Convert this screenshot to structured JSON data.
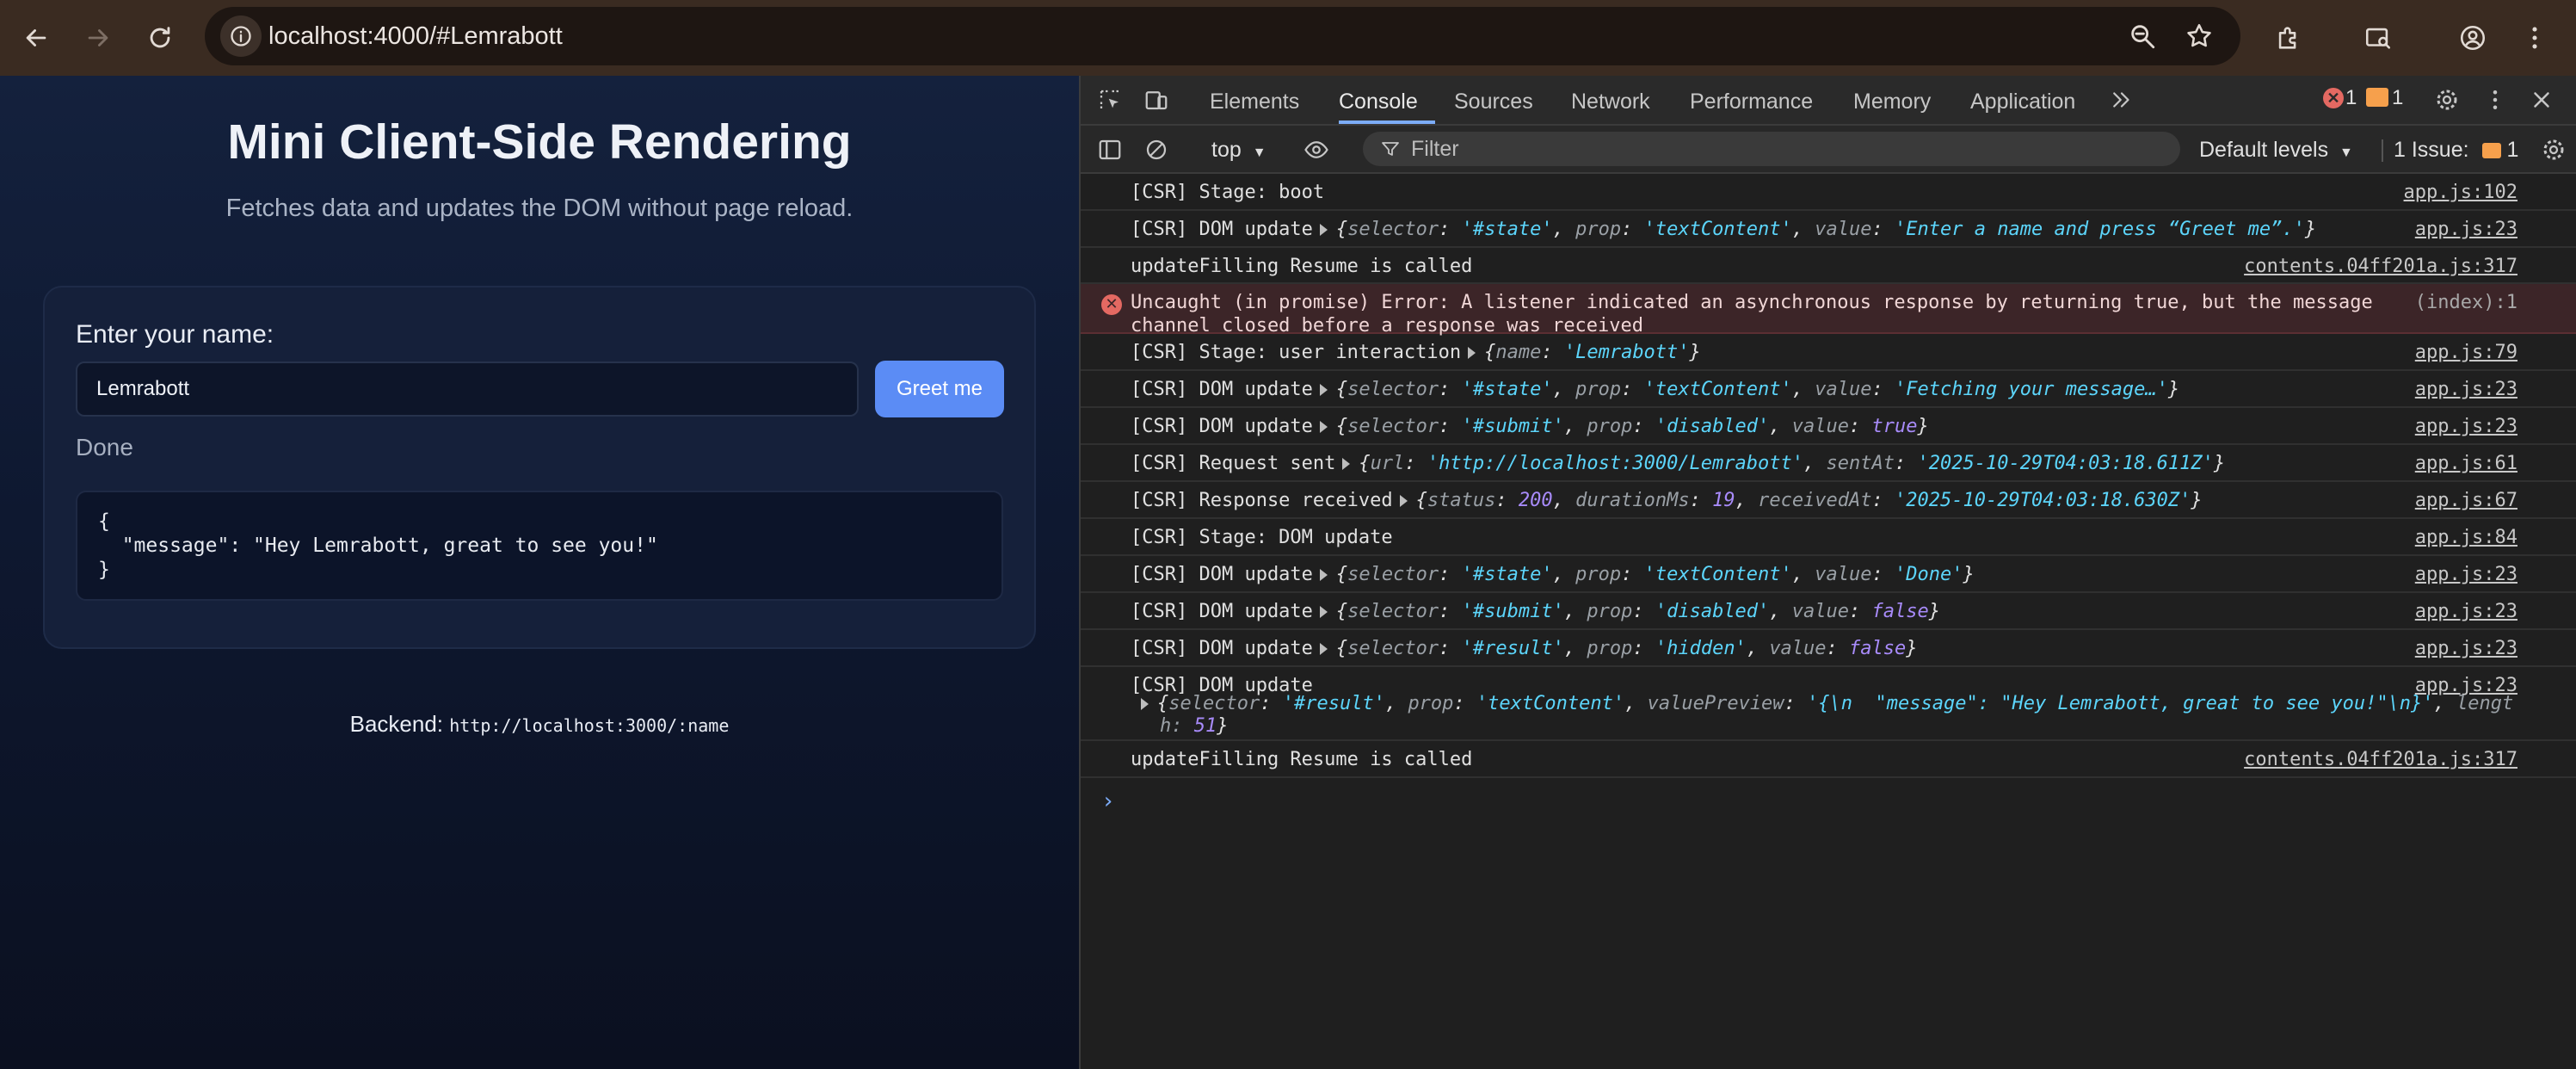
{
  "browser": {
    "url": "localhost:4000/#Lemrabott"
  },
  "page": {
    "title": "Mini Client-Side Rendering",
    "subtitle": "Fetches data and updates the DOM without page reload.",
    "name_label": "Enter your name:",
    "name_value": "Lemrabott",
    "greet_button": "Greet me",
    "state": "Done",
    "result": "{\n  \"message\": \"Hey Lemrabott, great to see you!\"\n}",
    "backend_label": "Backend:",
    "backend_url": "http://localhost:3000/:name"
  },
  "devtools": {
    "tabs": [
      "Elements",
      "Console",
      "Sources",
      "Network",
      "Performance",
      "Memory",
      "Application"
    ],
    "active_tab": "Console",
    "error_count": "1",
    "warning_count": "1",
    "context": "top",
    "filter_placeholder": "Filter",
    "levels": "Default levels",
    "issues_label": "1 Issue:",
    "issues_count": "1",
    "console": {
      "r1_msg": "[CSR] Stage: boot",
      "r1_src": "app.js:102",
      "r2_msg": "[CSR] DOM update",
      "r2_src": "app.js:23",
      "r2_state": "'#state'",
      "r2_prop": "'textContent'",
      "r2_value": "'Enter a name and press “Greet me”.'",
      "r3_msg": "updateFilling Resume is called",
      "r3_src": "contents.04ff201a.js:317",
      "r4_msg": "Uncaught (in promise) Error: A listener indicated an asynchronous response by returning true, but the message\nchannel closed before a response was received",
      "r4_src": "(index):1",
      "r5_msg": "[CSR] Stage: user interaction",
      "r5_name": "'Lemrabott'",
      "r5_src": "app.js:79",
      "r6_msg": "[CSR] DOM update",
      "r6_value": "'Fetching your message…'",
      "r6_src": "app.js:23",
      "r7_msg": "[CSR] DOM update",
      "r7_value": "true",
      "r7_src": "app.js:23",
      "r8_msg": "[CSR] Request sent",
      "r8_url": "'http://localhost:3000/Lemrabott'",
      "r8_sent": "'2025-10-29T04:03:18.611Z'",
      "r8_src": "app.js:61",
      "r9_msg": "[CSR] Response received",
      "r9_status": "200",
      "r9_duration": "19",
      "r9_received": "'2025-10-29T04:03:18.630Z'",
      "r9_src": "app.js:67",
      "r10_msg": "[CSR] Stage: DOM update",
      "r10_src": "app.js:84",
      "r11_msg": "[CSR] DOM update",
      "r11_value": "'Done'",
      "r11_src": "app.js:23",
      "r12_msg": "[CSR] DOM update",
      "r12_value": "false",
      "r12_src": "app.js:23",
      "r13_msg": "[CSR] DOM update",
      "r13_value": "false",
      "r13_src": "app.js:23",
      "r14_msg": "[CSR] DOM update",
      "r14_preview": "'{\\n  \"message\": \"Hey Lemrabott, great to see you!\"\\n}'",
      "r14_len1": "lengt",
      "r14_len2": "h:",
      "r14_len_val": "51",
      "r14_src": "app.js:23",
      "r15_msg": "updateFilling Resume is called",
      "r15_src": "contents.04ff201a.js:317"
    }
  }
}
